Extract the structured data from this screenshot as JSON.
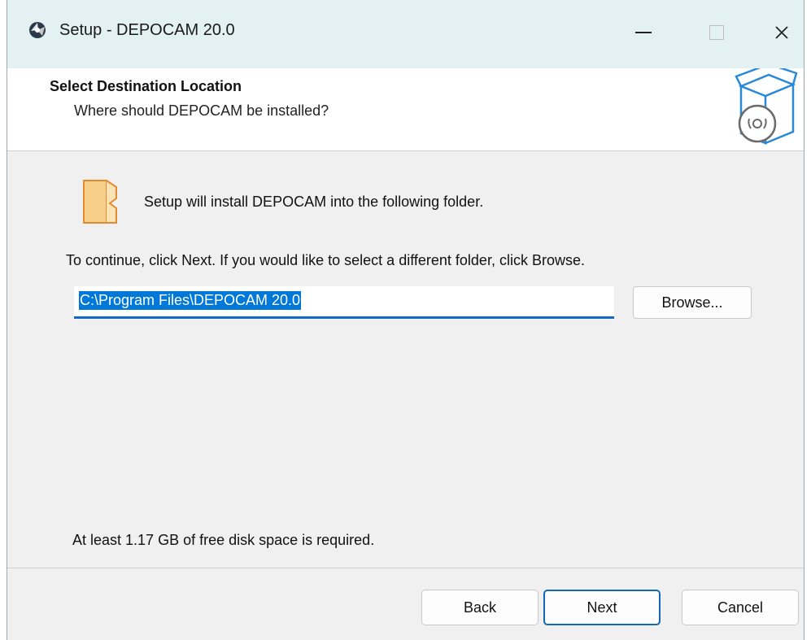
{
  "window": {
    "title": "Setup - DEPOCAM 20.0",
    "app_icon": "setup-app-icon",
    "controls": {
      "minimize": "minimize-icon",
      "maximize": "maximize-icon",
      "close": "×"
    }
  },
  "header": {
    "title": "Select Destination Location",
    "subtitle": "Where should DEPOCAM be installed?",
    "icon": "software-box-icon"
  },
  "main": {
    "folder_icon": "folder-icon",
    "intro": "Setup will install DEPOCAM into the following folder.",
    "instruction": "To continue, click Next. If you would like to select a different folder, click Browse.",
    "path_value": "C:\\Program Files\\DEPOCAM 20.0",
    "browse_label": "Browse...",
    "disk_space": "At least 1.17 GB of free disk space is required."
  },
  "footer": {
    "back_label": "Back",
    "next_label": "Next",
    "cancel_label": "Cancel"
  },
  "colors": {
    "titlebar": "#e3f1f3",
    "selection": "#0078d7",
    "accent_border": "#1467b8",
    "body": "#f0f0f0"
  }
}
